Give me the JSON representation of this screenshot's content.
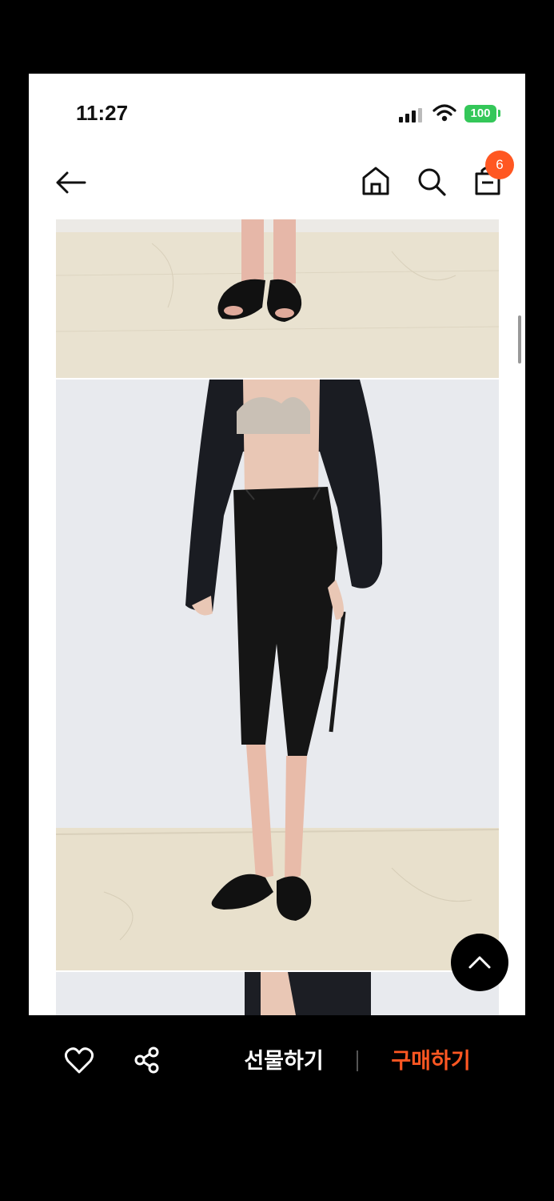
{
  "status_bar": {
    "time": "11:27",
    "battery": "100",
    "signal_icon": "cellular-signal-icon",
    "wifi_icon": "wifi-icon",
    "battery_color": "#34c759"
  },
  "nav": {
    "back_icon": "arrow-left-icon",
    "home_icon": "home-icon",
    "search_icon": "search-icon",
    "cart_icon": "shopping-bag-icon",
    "cart_count": "6",
    "badge_color": "#ff5722"
  },
  "content": {
    "images": [
      {
        "subject": "feet in black slide sandals on floor"
      },
      {
        "subject": "model in black shirt, beige bra top and black cropped pants"
      },
      {
        "subject": "next product photo (partially visible)"
      }
    ]
  },
  "scroll_top_icon": "chevron-up-icon",
  "bottom_bar": {
    "like_icon": "heart-icon",
    "share_icon": "share-icon",
    "gift_label": "선물하기",
    "buy_label": "구매하기",
    "buy_color": "#ff5722"
  }
}
